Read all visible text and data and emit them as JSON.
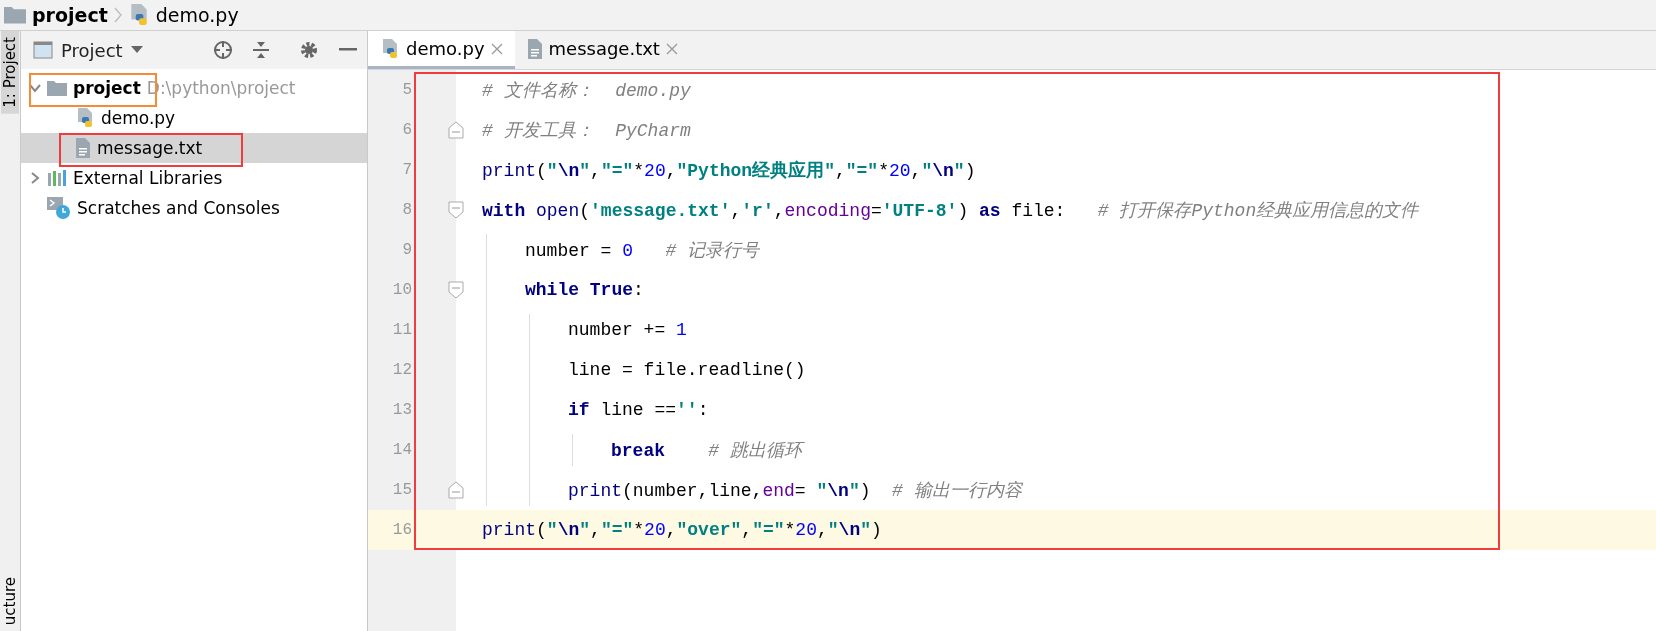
{
  "breadcrumb": [
    {
      "label": "project",
      "kind": "folder"
    },
    {
      "label": "demo.py",
      "kind": "python-file"
    }
  ],
  "tool_strip": {
    "top_tab": "1: Project",
    "bottom_tab": "ucture"
  },
  "project_panel": {
    "title": "Project",
    "tree": [
      {
        "label": "project",
        "kind": "folder",
        "path": "D:\\python\\project",
        "expanded": true,
        "selected": false,
        "annotation": {
          "color": "#f98a35"
        },
        "children": [
          {
            "label": "demo.py",
            "kind": "python-file",
            "selected": false
          },
          {
            "label": "message.txt",
            "kind": "text-file",
            "selected": true,
            "annotation": {
              "color": "#f03c3c"
            }
          }
        ]
      },
      {
        "label": "External Libraries",
        "kind": "library",
        "expanded": false,
        "selected": false
      },
      {
        "label": "Scratches and Consoles",
        "kind": "scratch",
        "selected": false
      }
    ]
  },
  "editor": {
    "tabs": [
      {
        "label": "demo.py",
        "kind": "python-file",
        "selected": true
      },
      {
        "label": "message.txt",
        "kind": "text-file",
        "selected": false
      }
    ],
    "annotation": {
      "color": "#f03c3c"
    },
    "lines": [
      {
        "number": "5",
        "current": false,
        "tokens": [
          {
            "kind": "comment",
            "s": "# 文件名称：  demo.py"
          }
        ]
      },
      {
        "number": "6",
        "current": false,
        "fold": {
          "kind": "end"
        },
        "tokens": [
          {
            "kind": "comment",
            "s": "# 开发工具：  PyCharm"
          }
        ]
      },
      {
        "number": "7",
        "current": false,
        "tokens": [
          {
            "kind": "builtin",
            "s": "print"
          },
          {
            "kind": "plain",
            "s": "("
          },
          {
            "kind": "string",
            "s": "\""
          },
          {
            "kind": "escape",
            "s": "\\n"
          },
          {
            "kind": "string",
            "s": "\""
          },
          {
            "kind": "plain",
            "s": ","
          },
          {
            "kind": "string",
            "s": "\"=\""
          },
          {
            "kind": "plain",
            "s": "*"
          },
          {
            "kind": "number",
            "s": "20"
          },
          {
            "kind": "plain",
            "s": ","
          },
          {
            "kind": "string",
            "s": "\"Python经典应用\""
          },
          {
            "kind": "plain",
            "s": ","
          },
          {
            "kind": "string",
            "s": "\"=\""
          },
          {
            "kind": "plain",
            "s": "*"
          },
          {
            "kind": "number",
            "s": "20"
          },
          {
            "kind": "plain",
            "s": ","
          },
          {
            "kind": "string",
            "s": "\""
          },
          {
            "kind": "escape",
            "s": "\\n"
          },
          {
            "kind": "string",
            "s": "\""
          },
          {
            "kind": "plain",
            "s": ")"
          }
        ]
      },
      {
        "number": "8",
        "current": false,
        "fold": {
          "kind": "start"
        },
        "tokens": [
          {
            "kind": "keyword",
            "s": "with"
          },
          {
            "kind": "builtin",
            "s": " open"
          },
          {
            "kind": "plain",
            "s": "("
          },
          {
            "kind": "string",
            "s": "'message.txt'"
          },
          {
            "kind": "plain",
            "s": ","
          },
          {
            "kind": "string",
            "s": "'r'"
          },
          {
            "kind": "plain",
            "s": ","
          },
          {
            "kind": "param",
            "s": "encoding"
          },
          {
            "kind": "plain",
            "s": "="
          },
          {
            "kind": "string",
            "s": "'UTF-8'"
          },
          {
            "kind": "plain",
            "s": ") "
          },
          {
            "kind": "keyword",
            "s": "as"
          },
          {
            "kind": "plain",
            "s": " file:"
          },
          {
            "kind": "comment",
            "s": "   # 打开保存Python经典应用信息的文件"
          }
        ],
        "children": [
          {
            "number": "9",
            "current": false,
            "tokens": [
              {
                "kind": "plain",
                "s": "number = "
              },
              {
                "kind": "number",
                "s": "0"
              },
              {
                "kind": "comment",
                "s": "   # 记录行号"
              }
            ]
          },
          {
            "number": "10",
            "current": false,
            "fold": {
              "kind": "start"
            },
            "tokens": [
              {
                "kind": "keyword",
                "s": "while True"
              },
              {
                "kind": "plain",
                "s": ":"
              }
            ],
            "children": [
              {
                "number": "11",
                "current": false,
                "tokens": [
                  {
                    "kind": "plain",
                    "s": "number += "
                  },
                  {
                    "kind": "number",
                    "s": "1"
                  }
                ]
              },
              {
                "number": "12",
                "current": false,
                "tokens": [
                  {
                    "kind": "plain",
                    "s": "line = file.readline()"
                  }
                ]
              },
              {
                "number": "13",
                "current": false,
                "tokens": [
                  {
                    "kind": "keyword",
                    "s": "if"
                  },
                  {
                    "kind": "plain",
                    "s": " line =="
                  },
                  {
                    "kind": "string",
                    "s": "''"
                  },
                  {
                    "kind": "plain",
                    "s": ":"
                  }
                ],
                "children": [
                  {
                    "number": "14",
                    "current": false,
                    "tokens": [
                      {
                        "kind": "keyword",
                        "s": "break"
                      },
                      {
                        "kind": "comment",
                        "s": "    # 跳出循环"
                      }
                    ]
                  }
                ]
              },
              {
                "number": "15",
                "current": false,
                "fold": {
                  "kind": "end"
                },
                "tokens": [
                  {
                    "kind": "builtin",
                    "s": "print"
                  },
                  {
                    "kind": "plain",
                    "s": "(number,line,"
                  },
                  {
                    "kind": "param",
                    "s": "end"
                  },
                  {
                    "kind": "plain",
                    "s": "= "
                  },
                  {
                    "kind": "string",
                    "s": "\""
                  },
                  {
                    "kind": "escape",
                    "s": "\\n"
                  },
                  {
                    "kind": "string",
                    "s": "\""
                  },
                  {
                    "kind": "plain",
                    "s": ")"
                  },
                  {
                    "kind": "comment",
                    "s": "  # 输出一行内容"
                  }
                ]
              }
            ]
          }
        ]
      },
      {
        "number": "16",
        "current": true,
        "tokens": [
          {
            "kind": "builtin",
            "s": "print"
          },
          {
            "kind": "plain",
            "s": "("
          },
          {
            "kind": "string",
            "s": "\""
          },
          {
            "kind": "escape",
            "s": "\\n"
          },
          {
            "kind": "string",
            "s": "\""
          },
          {
            "kind": "plain",
            "s": ","
          },
          {
            "kind": "string",
            "s": "\"=\""
          },
          {
            "kind": "plain",
            "s": "*"
          },
          {
            "kind": "number",
            "s": "20"
          },
          {
            "kind": "plain",
            "s": ","
          },
          {
            "kind": "string",
            "s": "\"over\""
          },
          {
            "kind": "plain",
            "s": ","
          },
          {
            "kind": "string",
            "s": "\"=\""
          },
          {
            "kind": "plain",
            "s": "*"
          },
          {
            "kind": "number",
            "s": "20"
          },
          {
            "kind": "plain",
            "s": ","
          },
          {
            "kind": "string",
            "s": "\""
          },
          {
            "kind": "escape",
            "s": "\\n"
          },
          {
            "kind": "string",
            "s": "\""
          },
          {
            "kind": "plain",
            "s": ")"
          }
        ]
      }
    ]
  }
}
